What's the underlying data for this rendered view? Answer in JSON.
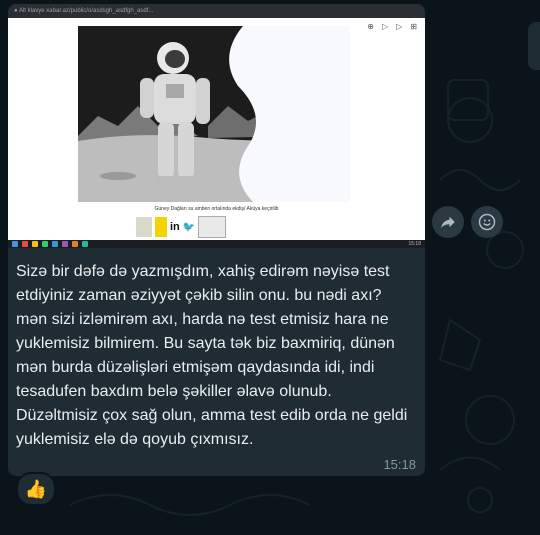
{
  "screenshot": {
    "browser_bar_text": "● Alt klavye   xabar.az/public/o/asdsgh_asdfgh_asdf...",
    "tools": [
      "⊕",
      "▷",
      "▷",
      "⊞"
    ],
    "caption": "Güney Dağları su amben ortalında ekdiş/ Aküya keçirilib",
    "share_text": "in",
    "share_bird": "🐦",
    "clock": "15:18"
  },
  "message": {
    "text": "Sizə bir dəfə də yazmışdım, xahiş edirəm nəyisə test etdiyiniz zaman əziyyət çəkib silin onu. bu nədi axı? mən sizi izləmirəm axı, harda nə test etmisiz hara ne yuklemisiz bilmirem. Bu sayta tək biz baxmiriq, dünən mən burda düzəlişləri etmişəm qaydasında idi, indi tesadufen baxdım belə şəkiller əlavə olunub. Düzəltmisiz çox sağ olun, amma test edib orda ne geldi yuklemisiz elə də qoyub çıxmısız.",
    "time": "15:18"
  },
  "reaction": {
    "emoji": "👍"
  },
  "icons": {
    "forward": "forward-icon",
    "emoji": "smiley-icon",
    "reaction": "thumbs-up-icon"
  },
  "colors": {
    "background": "#0b141a",
    "bubble": "#1f2c33",
    "text": "#e9edef",
    "meta": "#8696a0",
    "button": "#2a3942"
  }
}
